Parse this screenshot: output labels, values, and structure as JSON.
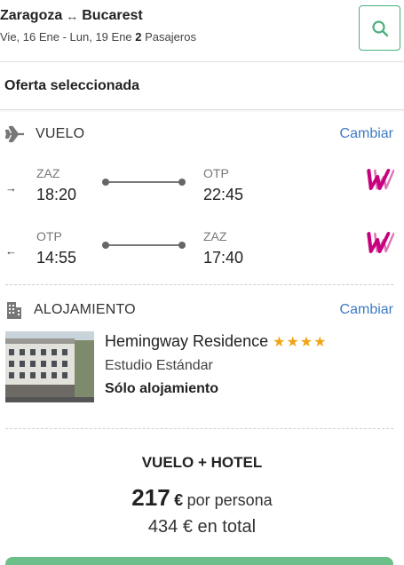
{
  "header": {
    "origin": "Zaragoza",
    "destination": "Bucarest",
    "route_arrow": "↔",
    "dates": "Vie, 16 Ene - Lun, 19 Ene",
    "passengers_count": "2",
    "passengers_label": "Pasajeros",
    "search_icon": "search-icon"
  },
  "offer": {
    "title": "Oferta seleccionada"
  },
  "flight_section": {
    "label": "VUELO",
    "change_label": "Cambiar",
    "icon": "airplane-icon",
    "outbound": {
      "direction_icon": "→",
      "from_code": "ZAZ",
      "from_time": "18:20",
      "to_code": "OTP",
      "to_time": "22:45",
      "airline_logo": "wizz-air-logo"
    },
    "return": {
      "direction_icon": "←",
      "from_code": "OTP",
      "from_time": "14:55",
      "to_code": "ZAZ",
      "to_time": "17:40",
      "airline_logo": "wizz-air-logo"
    }
  },
  "hotel_section": {
    "label": "ALOJAMIENTO",
    "change_label": "Cambiar",
    "icon": "building-icon",
    "name": "Hemingway Residence",
    "stars": 4,
    "stars_text": "★★★★",
    "room": "Estudio Estándar",
    "board": "Sólo alojamiento"
  },
  "package": {
    "title": "VUELO + HOTEL",
    "price": "217",
    "currency": "€",
    "per_person_label": "por persona",
    "total": "434 € en total"
  },
  "colors": {
    "accent_green": "#4caf7d",
    "link_blue": "#3d7bc4",
    "star_gold": "#f0a515",
    "cta_green": "#6cbf8b"
  }
}
